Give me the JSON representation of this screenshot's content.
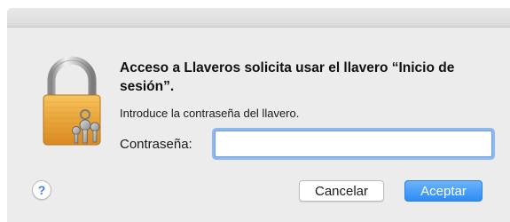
{
  "dialog": {
    "title": "Acceso a Llaveros solicita usar el llavero “Inicio de sesión”.",
    "message": "Introduce la contraseña del llavero.",
    "password_label": "Contraseña:",
    "password_value": "",
    "password_placeholder": ""
  },
  "buttons": {
    "help_label": "?",
    "cancel_label": "Cancelar",
    "accept_label": "Aceptar"
  },
  "icons": {
    "main": "lock-with-keys-icon",
    "help": "help-icon"
  },
  "colors": {
    "accent": "#2d8cf4",
    "focus_ring": "#8fb8ef",
    "dialog_background": "#ececec"
  }
}
